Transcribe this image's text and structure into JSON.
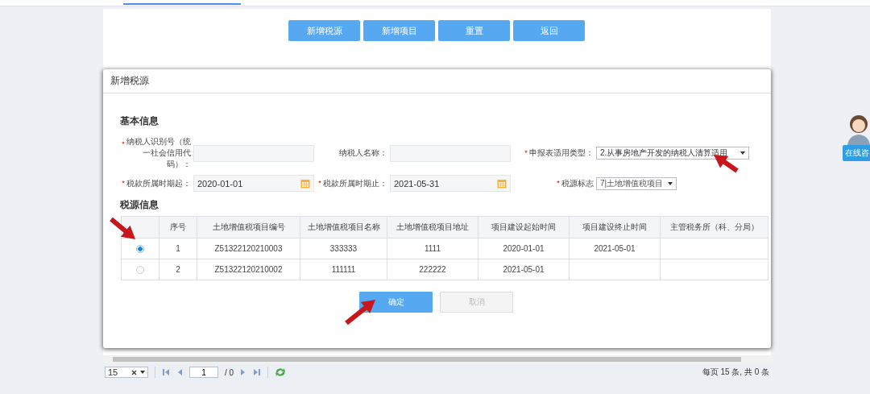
{
  "toolbar": {
    "buttons": [
      "新增税源",
      "新增项目",
      "重置",
      "返回"
    ]
  },
  "dialog": {
    "title": "新增税源",
    "basic_section": {
      "heading": "基本信息",
      "fields": [
        {
          "label": "纳税人识别号（统一社会信用代码）：",
          "required": true,
          "kind": "text"
        },
        {
          "label": "纳税人名称：",
          "required": false,
          "kind": "text"
        },
        {
          "label": "申报表适用类型：",
          "required": true,
          "kind": "select",
          "value": "2.从事房地产开发的纳税人清算适用"
        },
        {
          "label": "税款所属时期起：",
          "required": true,
          "kind": "date",
          "value": "2020-01-01"
        },
        {
          "label": "税款所属时期止：",
          "required": true,
          "kind": "date",
          "value": "2021-05-31"
        },
        {
          "label": "税源标志",
          "required": true,
          "kind": "select",
          "value": "7|土地增值税项目"
        }
      ]
    },
    "source_section": {
      "heading": "税源信息",
      "table": {
        "columns": [
          "序号",
          "土地增值税项目编号",
          "土地增值税项目名称",
          "土地增值税项目地址",
          "项目建设起始时间",
          "项目建设终止时间",
          "主管税务所（科、分局）"
        ],
        "rows": [
          {
            "selected": true,
            "cells": [
              "1",
              "Z51322120210003",
              "333333",
              "1111",
              "2020-01-01",
              "2021-05-01",
              ""
            ]
          },
          {
            "selected": false,
            "cells": [
              "2",
              "Z51322120210002",
              "111111",
              "222222",
              "2021-05-01",
              "",
              ""
            ]
          }
        ]
      }
    },
    "buttons": [
      {
        "label": "确定",
        "disabled": false
      },
      {
        "label": "取消",
        "disabled": true
      }
    ]
  },
  "pager": {
    "page_size": "15",
    "page": "1",
    "total_pages": "/ 0",
    "summary": "每页 15 条, 共 0 条"
  },
  "chat_widget": {
    "label": "在线咨"
  }
}
